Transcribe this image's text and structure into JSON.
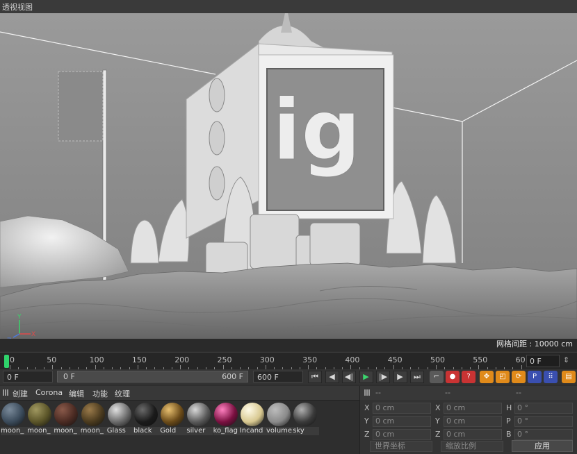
{
  "viewport": {
    "title": "透视视图",
    "grid_spacing_label": "网格间距 : 10000 cm",
    "axis_labels": {
      "x": "X",
      "y": "Y",
      "z": "Z"
    },
    "scene_text": "ig"
  },
  "timeline": {
    "ticks": [
      "0",
      "50",
      "100",
      "150",
      "200",
      "250",
      "300",
      "350",
      "400",
      "450",
      "500",
      "550",
      "60"
    ],
    "current_frame": "0 F"
  },
  "transport": {
    "start_field": "0 F",
    "range_start": "0 F",
    "range_end": "600 F",
    "end_field": "600 F",
    "buttons": [
      {
        "name": "go-to-start",
        "glyph": "⏮"
      },
      {
        "name": "prev-key",
        "glyph": "◀"
      },
      {
        "name": "prev-frame",
        "glyph": "◀|"
      },
      {
        "name": "play",
        "glyph": "▶"
      },
      {
        "name": "next-frame",
        "glyph": "|▶"
      },
      {
        "name": "next-key",
        "glyph": "▶"
      },
      {
        "name": "go-to-end",
        "glyph": "⏭"
      }
    ],
    "record_buttons": [
      {
        "name": "keyframe-key",
        "glyph": "⌐",
        "color": "#5a5a5a"
      },
      {
        "name": "record-active",
        "glyph": "●",
        "color": "#c93333"
      },
      {
        "name": "autokey",
        "glyph": "?",
        "color": "#c93333"
      },
      {
        "name": "move-key",
        "glyph": "✥",
        "color": "#e08a1a"
      },
      {
        "name": "scale-key",
        "glyph": "◰",
        "color": "#e08a1a"
      },
      {
        "name": "rotate-key",
        "glyph": "⟳",
        "color": "#e08a1a"
      },
      {
        "name": "param-key",
        "glyph": "P",
        "color": "#3a4fb0"
      },
      {
        "name": "point-level",
        "glyph": "⠿",
        "color": "#3a4fb0"
      },
      {
        "name": "timeline-open",
        "glyph": "▤",
        "color": "#e08a1a"
      }
    ]
  },
  "material_menu": [
    "创建",
    "Corona",
    "编辑",
    "功能",
    "纹理"
  ],
  "materials": [
    {
      "name": "moon_",
      "color": "#3a4a5a",
      "hl": "#7a8a9a"
    },
    {
      "name": "moon_",
      "color": "#5a5428",
      "hl": "#a09860"
    },
    {
      "name": "moon_",
      "color": "#4a2a22",
      "hl": "#8a5a4a"
    },
    {
      "name": "moon_",
      "color": "#4a3a1e",
      "hl": "#9a7a4a"
    },
    {
      "name": "Glass",
      "color": "#6a6a6a",
      "hl": "#e0e0e0"
    },
    {
      "name": "black",
      "color": "#1a1a1a",
      "hl": "#6a6a6a"
    },
    {
      "name": "Gold",
      "color": "#6a4a18",
      "hl": "#e8c070"
    },
    {
      "name": "silver",
      "color": "#5a5a5a",
      "hl": "#d8d8d8"
    },
    {
      "name": "ko_flag",
      "color": "#7a1040",
      "hl": "#ff80c0"
    },
    {
      "name": "Incand",
      "color": "#d8c890",
      "hl": "#fffbe8"
    },
    {
      "name": "volume",
      "color": "#8a8a8a",
      "hl": "#bcbcbc"
    },
    {
      "name": "sky",
      "color": "#3a3a3a",
      "hl": "#b0b0b0"
    }
  ],
  "coordinates": {
    "headers": [
      "--",
      "--",
      "--"
    ],
    "rows": [
      {
        "l1": "X",
        "v1": "0 cm",
        "l2": "X",
        "v2": "0 cm",
        "l3": "H",
        "v3": "0 °"
      },
      {
        "l1": "Y",
        "v1": "0 cm",
        "l2": "Y",
        "v2": "0 cm",
        "l3": "P",
        "v3": "0 °"
      },
      {
        "l1": "Z",
        "v1": "0 cm",
        "l2": "Z",
        "v2": "0 cm",
        "l3": "B",
        "v3": "0 °"
      }
    ],
    "world_dropdown": "世界坐标",
    "scale_dropdown": "缩放比例",
    "apply_label": "应用"
  }
}
